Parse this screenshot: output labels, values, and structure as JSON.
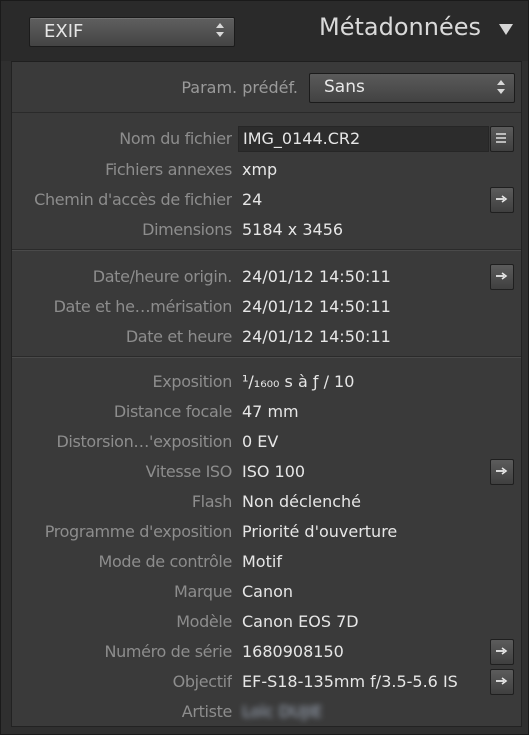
{
  "header": {
    "exif_select": "EXIF",
    "title": "Métadonnées"
  },
  "preset": {
    "label": "Param. prédéf.",
    "value": "Sans"
  },
  "fields": [
    {
      "k": "Nom du fichier",
      "v": "IMG_0144.CR2"
    },
    {
      "k": "Fichiers annexes",
      "v": "xmp"
    },
    {
      "k": "Chemin d'accès de fichier",
      "v": "24"
    },
    {
      "k": "Dimensions",
      "v": "5184 x 3456"
    },
    {
      "k": "Date/heure origin.",
      "v": "24/01/12 14:50:11"
    },
    {
      "k": "Date et he…mérisation",
      "v": "24/01/12 14:50:11"
    },
    {
      "k": "Date et heure",
      "v": "24/01/12 14:50:11"
    },
    {
      "k": "Exposition",
      "v": "¹/₁₆₀₀ s à ƒ / 10"
    },
    {
      "k": "Distance focale",
      "v": "47 mm"
    },
    {
      "k": "Distorsion…'exposition",
      "v": "0 EV"
    },
    {
      "k": "Vitesse ISO",
      "v": "ISO 100"
    },
    {
      "k": "Flash",
      "v": "Non déclenché"
    },
    {
      "k": "Programme d'exposition",
      "v": "Priorité d'ouverture"
    },
    {
      "k": "Mode de contrôle",
      "v": "Motif"
    },
    {
      "k": "Marque",
      "v": "Canon"
    },
    {
      "k": "Modèle",
      "v": "Canon EOS 7D"
    },
    {
      "k": "Numéro de série",
      "v": "1680908150"
    },
    {
      "k": "Objectif",
      "v": "EF-S18-135mm f/3.5-5.6 IS"
    },
    {
      "k": "Artiste",
      "v": "Loïc DUJIE"
    }
  ]
}
